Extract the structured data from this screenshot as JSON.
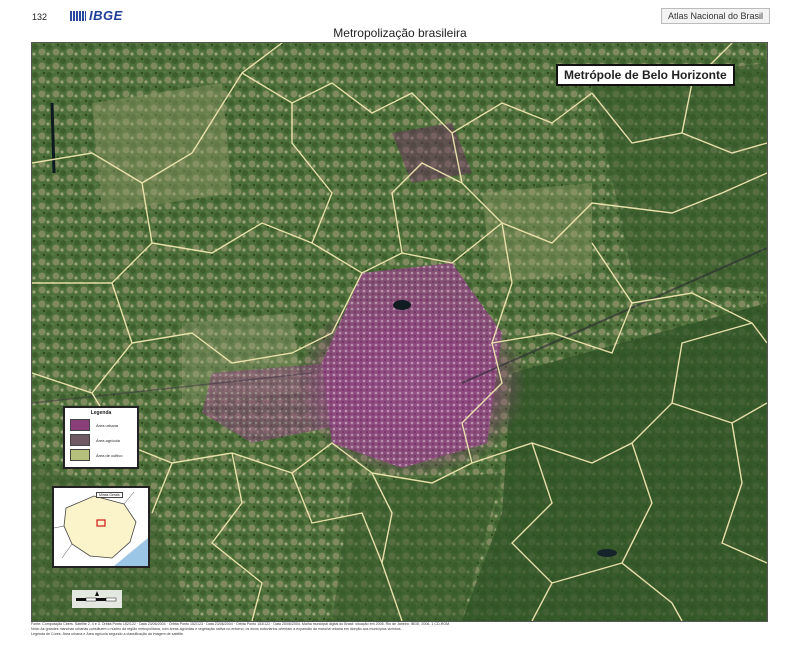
{
  "header": {
    "page_number": "132",
    "logo_text": "IBGE",
    "atlas_name": "Atlas Nacional do Brasil"
  },
  "page_title": "Metropolização brasileira",
  "map": {
    "title": "Metrópole de Belo Horizonte",
    "legend": {
      "title": "Legenda",
      "items": [
        {
          "label": "Área urbana",
          "color": "#8a3f7a"
        },
        {
          "label": "Área agrícola",
          "color": "#6f5a63"
        },
        {
          "label": "Área de cultivo",
          "color": "#b5c07a"
        }
      ]
    },
    "inset": {
      "caption": "Minas Gerais"
    },
    "colors": {
      "vegetation": "#4a6b36",
      "field": "#8d9468",
      "urban": "#8a3f7a",
      "boundary": "#f0e6b0"
    }
  },
  "notes": {
    "line1": "Fonte: Composição Cbers. Satélite 2, 4 e 3. Órbita Ponto 152/122 · Data 23/06/2004 · Órbita Ponto 152/123 · Data 23/06/2004 · Órbita Ponto 153/122 · Data 25/06/2004. Malha municipal digital do Brasil: situação em 2005. Rio de Janeiro: IBGE, 2006. 1 CD-ROM.",
    "line2": "Nota: As grandes manchas urbanas constituem o núcleo da região metropolitana, com áreas agrícolas e vegetação nativa no entorno; os eixos rodoviários orientam a expansão da mancha urbana em direção aos municípios vizinhos.",
    "line3": "Legenda de Cores: Área urbana e Área agrícola segundo a classificação da imagem de satélite."
  }
}
